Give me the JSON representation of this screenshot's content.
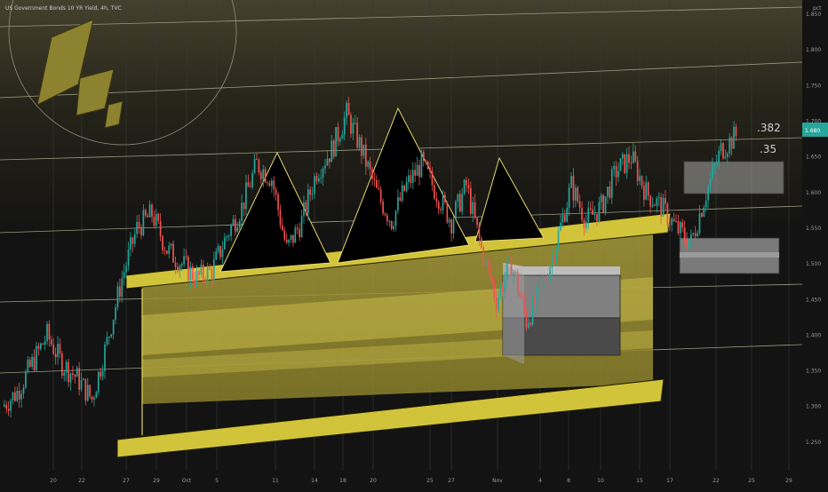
{
  "header": {
    "symbol_title": "US Government Bonds 10 YR Yield, 4h, TVC"
  },
  "price_scale": {
    "unit_label": "pct",
    "current_price_label": "1.680",
    "current_price_color": "#26a69a"
  },
  "colors": {
    "up": "#26a69a",
    "down": "#ef5350",
    "zone_yellow": "#d2c43a",
    "shape_black": "#000000",
    "background": "#131313"
  },
  "fib_labels": [
    ".382",
    ".35"
  ],
  "chart_data": {
    "type": "candlestick",
    "title": "US Government Bonds 10 YR Yield, 4h, TVC",
    "ylabel": "pct",
    "ylim": [
      1.21,
      1.87
    ],
    "y_ticks": [
      "1.850",
      "1.800",
      "1.750",
      "1.700",
      "1.650",
      "1.600",
      "1.550",
      "1.500",
      "1.450",
      "1.400",
      "1.350",
      "1.300",
      "1.250"
    ],
    "x_ticks": [
      "20",
      "22",
      "27",
      "29",
      "Oct",
      "5",
      "11",
      "14",
      "18",
      "20",
      "25",
      "27",
      "Nov",
      "4",
      "8",
      "10",
      "15",
      "17",
      "22",
      "25",
      "29"
    ],
    "price_path": [
      [
        1.3,
        1.32
      ],
      [
        1.32,
        1.36
      ],
      [
        1.36,
        1.4
      ],
      [
        1.4,
        1.36
      ],
      [
        1.36,
        1.34
      ],
      [
        1.34,
        1.31
      ],
      [
        1.31,
        1.39
      ],
      [
        1.39,
        1.48
      ],
      [
        1.48,
        1.55
      ],
      [
        1.55,
        1.57
      ],
      [
        1.57,
        1.52
      ],
      [
        1.52,
        1.5
      ],
      [
        1.5,
        1.48
      ],
      [
        1.48,
        1.49
      ],
      [
        1.49,
        1.54
      ],
      [
        1.54,
        1.58
      ],
      [
        1.58,
        1.64
      ],
      [
        1.64,
        1.62
      ],
      [
        1.62,
        1.52
      ],
      [
        1.52,
        1.56
      ],
      [
        1.56,
        1.63
      ],
      [
        1.63,
        1.66
      ],
      [
        1.66,
        1.71
      ],
      [
        1.71,
        1.66
      ],
      [
        1.66,
        1.6
      ],
      [
        1.6,
        1.56
      ],
      [
        1.56,
        1.61
      ],
      [
        1.61,
        1.64
      ],
      [
        1.64,
        1.6
      ],
      [
        1.6,
        1.56
      ],
      [
        1.56,
        1.61
      ],
      [
        1.61,
        1.52
      ],
      [
        1.52,
        1.45
      ],
      [
        1.45,
        1.5
      ],
      [
        1.5,
        1.42
      ],
      [
        1.42,
        1.46
      ],
      [
        1.46,
        1.53
      ],
      [
        1.53,
        1.61
      ],
      [
        1.61,
        1.56
      ],
      [
        1.56,
        1.58
      ],
      [
        1.58,
        1.63
      ],
      [
        1.63,
        1.65
      ],
      [
        1.65,
        1.6
      ],
      [
        1.6,
        1.58
      ],
      [
        1.58,
        1.55
      ],
      [
        1.55,
        1.53
      ],
      [
        1.53,
        1.6
      ],
      [
        1.6,
        1.66
      ],
      [
        1.66,
        1.68
      ]
    ]
  }
}
